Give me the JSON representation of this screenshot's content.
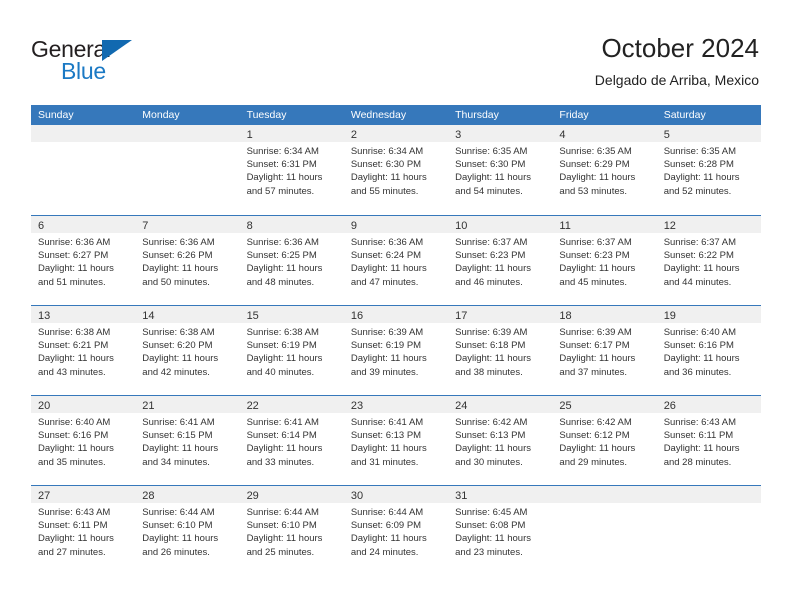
{
  "brand": {
    "name_top": "General",
    "name_bottom": "Blue",
    "triangle_color": "#1169b0",
    "blue_color": "#1b79c4"
  },
  "header": {
    "title": "October 2024",
    "subtitle": "Delgado de Arriba, Mexico"
  },
  "theme": {
    "header_blue": "#3678bb",
    "day_band_gray": "#f0f0f0",
    "text_color": "#333333"
  },
  "weekdays": [
    "Sunday",
    "Monday",
    "Tuesday",
    "Wednesday",
    "Thursday",
    "Friday",
    "Saturday"
  ],
  "weeks": [
    [
      {
        "day": "",
        "sunrise": "",
        "sunset": "",
        "daylight_a": "",
        "daylight_b": ""
      },
      {
        "day": "",
        "sunrise": "",
        "sunset": "",
        "daylight_a": "",
        "daylight_b": ""
      },
      {
        "day": "1",
        "sunrise": "Sunrise: 6:34 AM",
        "sunset": "Sunset: 6:31 PM",
        "daylight_a": "Daylight: 11 hours",
        "daylight_b": "and 57 minutes."
      },
      {
        "day": "2",
        "sunrise": "Sunrise: 6:34 AM",
        "sunset": "Sunset: 6:30 PM",
        "daylight_a": "Daylight: 11 hours",
        "daylight_b": "and 55 minutes."
      },
      {
        "day": "3",
        "sunrise": "Sunrise: 6:35 AM",
        "sunset": "Sunset: 6:30 PM",
        "daylight_a": "Daylight: 11 hours",
        "daylight_b": "and 54 minutes."
      },
      {
        "day": "4",
        "sunrise": "Sunrise: 6:35 AM",
        "sunset": "Sunset: 6:29 PM",
        "daylight_a": "Daylight: 11 hours",
        "daylight_b": "and 53 minutes."
      },
      {
        "day": "5",
        "sunrise": "Sunrise: 6:35 AM",
        "sunset": "Sunset: 6:28 PM",
        "daylight_a": "Daylight: 11 hours",
        "daylight_b": "and 52 minutes."
      }
    ],
    [
      {
        "day": "6",
        "sunrise": "Sunrise: 6:36 AM",
        "sunset": "Sunset: 6:27 PM",
        "daylight_a": "Daylight: 11 hours",
        "daylight_b": "and 51 minutes."
      },
      {
        "day": "7",
        "sunrise": "Sunrise: 6:36 AM",
        "sunset": "Sunset: 6:26 PM",
        "daylight_a": "Daylight: 11 hours",
        "daylight_b": "and 50 minutes."
      },
      {
        "day": "8",
        "sunrise": "Sunrise: 6:36 AM",
        "sunset": "Sunset: 6:25 PM",
        "daylight_a": "Daylight: 11 hours",
        "daylight_b": "and 48 minutes."
      },
      {
        "day": "9",
        "sunrise": "Sunrise: 6:36 AM",
        "sunset": "Sunset: 6:24 PM",
        "daylight_a": "Daylight: 11 hours",
        "daylight_b": "and 47 minutes."
      },
      {
        "day": "10",
        "sunrise": "Sunrise: 6:37 AM",
        "sunset": "Sunset: 6:23 PM",
        "daylight_a": "Daylight: 11 hours",
        "daylight_b": "and 46 minutes."
      },
      {
        "day": "11",
        "sunrise": "Sunrise: 6:37 AM",
        "sunset": "Sunset: 6:23 PM",
        "daylight_a": "Daylight: 11 hours",
        "daylight_b": "and 45 minutes."
      },
      {
        "day": "12",
        "sunrise": "Sunrise: 6:37 AM",
        "sunset": "Sunset: 6:22 PM",
        "daylight_a": "Daylight: 11 hours",
        "daylight_b": "and 44 minutes."
      }
    ],
    [
      {
        "day": "13",
        "sunrise": "Sunrise: 6:38 AM",
        "sunset": "Sunset: 6:21 PM",
        "daylight_a": "Daylight: 11 hours",
        "daylight_b": "and 43 minutes."
      },
      {
        "day": "14",
        "sunrise": "Sunrise: 6:38 AM",
        "sunset": "Sunset: 6:20 PM",
        "daylight_a": "Daylight: 11 hours",
        "daylight_b": "and 42 minutes."
      },
      {
        "day": "15",
        "sunrise": "Sunrise: 6:38 AM",
        "sunset": "Sunset: 6:19 PM",
        "daylight_a": "Daylight: 11 hours",
        "daylight_b": "and 40 minutes."
      },
      {
        "day": "16",
        "sunrise": "Sunrise: 6:39 AM",
        "sunset": "Sunset: 6:19 PM",
        "daylight_a": "Daylight: 11 hours",
        "daylight_b": "and 39 minutes."
      },
      {
        "day": "17",
        "sunrise": "Sunrise: 6:39 AM",
        "sunset": "Sunset: 6:18 PM",
        "daylight_a": "Daylight: 11 hours",
        "daylight_b": "and 38 minutes."
      },
      {
        "day": "18",
        "sunrise": "Sunrise: 6:39 AM",
        "sunset": "Sunset: 6:17 PM",
        "daylight_a": "Daylight: 11 hours",
        "daylight_b": "and 37 minutes."
      },
      {
        "day": "19",
        "sunrise": "Sunrise: 6:40 AM",
        "sunset": "Sunset: 6:16 PM",
        "daylight_a": "Daylight: 11 hours",
        "daylight_b": "and 36 minutes."
      }
    ],
    [
      {
        "day": "20",
        "sunrise": "Sunrise: 6:40 AM",
        "sunset": "Sunset: 6:16 PM",
        "daylight_a": "Daylight: 11 hours",
        "daylight_b": "and 35 minutes."
      },
      {
        "day": "21",
        "sunrise": "Sunrise: 6:41 AM",
        "sunset": "Sunset: 6:15 PM",
        "daylight_a": "Daylight: 11 hours",
        "daylight_b": "and 34 minutes."
      },
      {
        "day": "22",
        "sunrise": "Sunrise: 6:41 AM",
        "sunset": "Sunset: 6:14 PM",
        "daylight_a": "Daylight: 11 hours",
        "daylight_b": "and 33 minutes."
      },
      {
        "day": "23",
        "sunrise": "Sunrise: 6:41 AM",
        "sunset": "Sunset: 6:13 PM",
        "daylight_a": "Daylight: 11 hours",
        "daylight_b": "and 31 minutes."
      },
      {
        "day": "24",
        "sunrise": "Sunrise: 6:42 AM",
        "sunset": "Sunset: 6:13 PM",
        "daylight_a": "Daylight: 11 hours",
        "daylight_b": "and 30 minutes."
      },
      {
        "day": "25",
        "sunrise": "Sunrise: 6:42 AM",
        "sunset": "Sunset: 6:12 PM",
        "daylight_a": "Daylight: 11 hours",
        "daylight_b": "and 29 minutes."
      },
      {
        "day": "26",
        "sunrise": "Sunrise: 6:43 AM",
        "sunset": "Sunset: 6:11 PM",
        "daylight_a": "Daylight: 11 hours",
        "daylight_b": "and 28 minutes."
      }
    ],
    [
      {
        "day": "27",
        "sunrise": "Sunrise: 6:43 AM",
        "sunset": "Sunset: 6:11 PM",
        "daylight_a": "Daylight: 11 hours",
        "daylight_b": "and 27 minutes."
      },
      {
        "day": "28",
        "sunrise": "Sunrise: 6:44 AM",
        "sunset": "Sunset: 6:10 PM",
        "daylight_a": "Daylight: 11 hours",
        "daylight_b": "and 26 minutes."
      },
      {
        "day": "29",
        "sunrise": "Sunrise: 6:44 AM",
        "sunset": "Sunset: 6:10 PM",
        "daylight_a": "Daylight: 11 hours",
        "daylight_b": "and 25 minutes."
      },
      {
        "day": "30",
        "sunrise": "Sunrise: 6:44 AM",
        "sunset": "Sunset: 6:09 PM",
        "daylight_a": "Daylight: 11 hours",
        "daylight_b": "and 24 minutes."
      },
      {
        "day": "31",
        "sunrise": "Sunrise: 6:45 AM",
        "sunset": "Sunset: 6:08 PM",
        "daylight_a": "Daylight: 11 hours",
        "daylight_b": "and 23 minutes."
      },
      {
        "day": "",
        "sunrise": "",
        "sunset": "",
        "daylight_a": "",
        "daylight_b": ""
      },
      {
        "day": "",
        "sunrise": "",
        "sunset": "",
        "daylight_a": "",
        "daylight_b": ""
      }
    ]
  ]
}
